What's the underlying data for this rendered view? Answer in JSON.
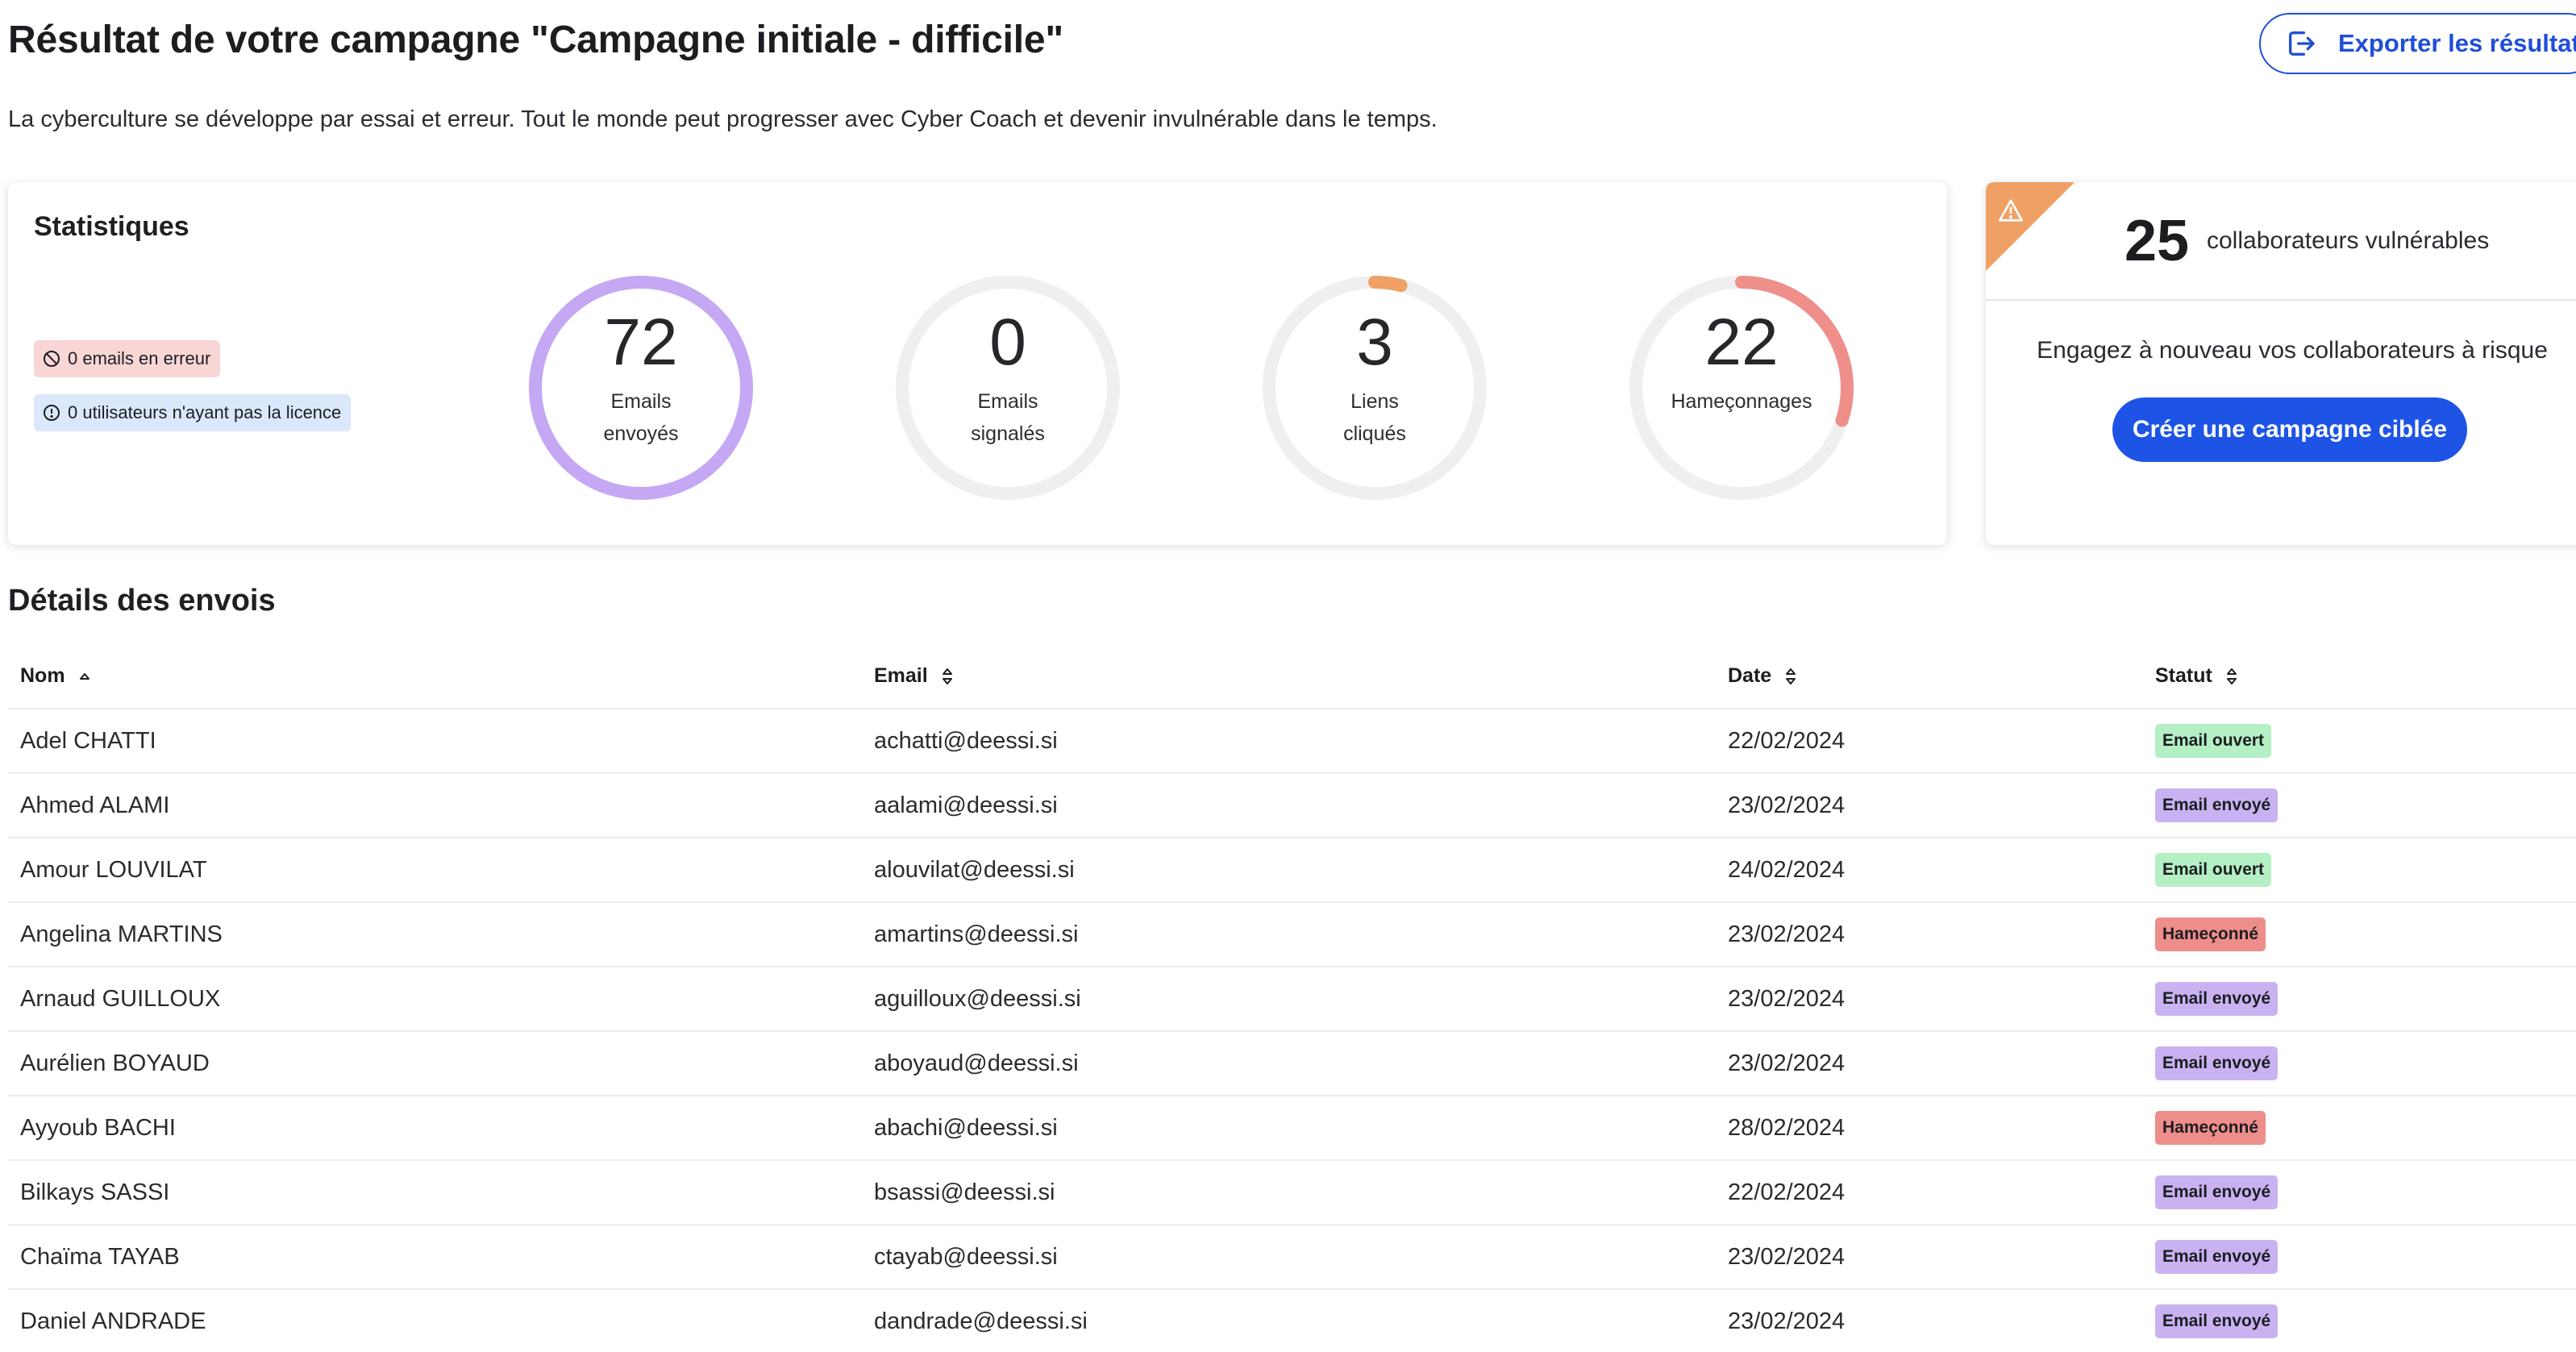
{
  "header": {
    "title": "Résultat de votre campagne \"Campagne initiale - difficile\"",
    "subtitle": "La cyberculture se développe par essai et erreur. Tout le monde peut progresser avec Cyber Coach et devenir invulnérable dans le temps.",
    "export_label": "Exporter les résultats",
    "export_icon": "export-icon"
  },
  "stats": {
    "title": "Statistiques",
    "errors_badge": "0 emails en erreur",
    "licence_badge": "0 utilisateurs n'ayant pas la licence",
    "rings": [
      {
        "value": "72",
        "label_line1": "Emails",
        "label_line2": "envoyés",
        "color": "#c4a8f4",
        "fraction": 1.0
      },
      {
        "value": "0",
        "label_line1": "Emails",
        "label_line2": "signalés",
        "color": "#c4a8f4",
        "fraction": 0.0
      },
      {
        "value": "3",
        "label_line1": "Liens",
        "label_line2": "cliqués",
        "color": "#f0a064",
        "fraction": 0.04
      },
      {
        "value": "22",
        "label_line1": "Hameçonnages",
        "label_line2": "",
        "color": "#ee8f8a",
        "fraction": 0.3
      }
    ]
  },
  "vulnerable": {
    "count": "25",
    "text": "collaborateurs vulnérables",
    "cta_text": "Engagez à nouveau vos collaborateurs à risque",
    "cta_button": "Créer une campagne ciblée",
    "warning_color": "#f0a064"
  },
  "details": {
    "title": "Détails des envois",
    "columns": {
      "nom": "Nom",
      "email": "Email",
      "date": "Date",
      "statut": "Statut"
    },
    "status_colors": {
      "Email ouvert": "#b4f0c4",
      "Email envoyé": "#c9b2f2",
      "Hameçonné": "#ee8e8a"
    },
    "rows": [
      {
        "nom": "Adel CHATTI",
        "email": "achatti@deessi.si",
        "date": "22/02/2024",
        "statut": "Email ouvert"
      },
      {
        "nom": "Ahmed ALAMI",
        "email": "aalami@deessi.si",
        "date": "23/02/2024",
        "statut": "Email envoyé"
      },
      {
        "nom": "Amour LOUVILAT",
        "email": "alouvilat@deessi.si",
        "date": "24/02/2024",
        "statut": "Email ouvert"
      },
      {
        "nom": "Angelina MARTINS",
        "email": "amartins@deessi.si",
        "date": "23/02/2024",
        "statut": "Hameçonné"
      },
      {
        "nom": "Arnaud GUILLOUX",
        "email": "aguilloux@deessi.si",
        "date": "23/02/2024",
        "statut": "Email envoyé"
      },
      {
        "nom": "Aurélien BOYAUD",
        "email": "aboyaud@deessi.si",
        "date": "23/02/2024",
        "statut": "Email envoyé"
      },
      {
        "nom": "Ayyoub BACHI",
        "email": "abachi@deessi.si",
        "date": "28/02/2024",
        "statut": "Hameçonné"
      },
      {
        "nom": "Bilkays SASSI",
        "email": "bsassi@deessi.si",
        "date": "22/02/2024",
        "statut": "Email envoyé"
      },
      {
        "nom": "Chaïma TAYAB",
        "email": "ctayab@deessi.si",
        "date": "23/02/2024",
        "statut": "Email envoyé"
      },
      {
        "nom": "Daniel ANDRADE",
        "email": "dandrade@deessi.si",
        "date": "23/02/2024",
        "statut": "Email envoyé"
      }
    ]
  }
}
